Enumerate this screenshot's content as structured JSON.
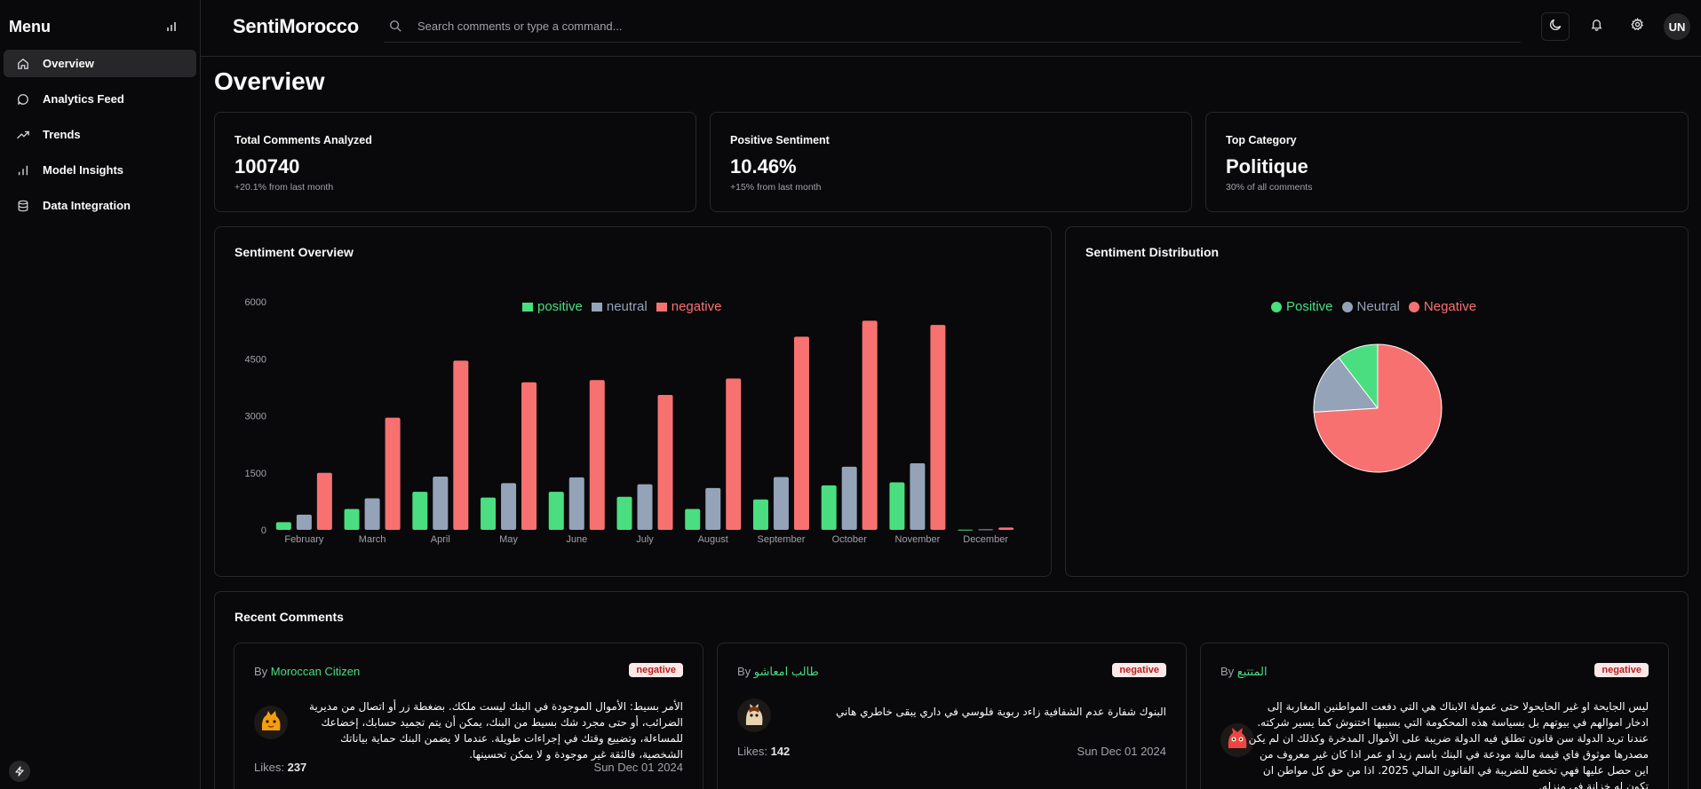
{
  "sidebar": {
    "title": "Menu",
    "items": [
      {
        "label": "Overview",
        "icon": "home-icon",
        "active": true
      },
      {
        "label": "Analytics Feed",
        "icon": "message-icon"
      },
      {
        "label": "Trends",
        "icon": "trending-up-icon"
      },
      {
        "label": "Model Insights",
        "icon": "bar-chart-icon"
      },
      {
        "label": "Data Integration",
        "icon": "database-icon"
      }
    ]
  },
  "header": {
    "brand": "SentiMorocco",
    "search_placeholder": "Search comments or type a command...",
    "avatar_initials": "UN"
  },
  "page": {
    "title": "Overview"
  },
  "stats": [
    {
      "label": "Total Comments Analyzed",
      "value": "100740",
      "sub": "+20.1% from last month"
    },
    {
      "label": "Positive Sentiment",
      "value": "10.46%",
      "sub": "+15% from last month"
    },
    {
      "label": "Top Category",
      "value": "Politique",
      "sub": "30% of all comments"
    }
  ],
  "sentiment_overview": {
    "title": "Sentiment Overview"
  },
  "sentiment_distribution": {
    "title": "Sentiment Distribution"
  },
  "chart_data": [
    {
      "type": "bar",
      "title": "Sentiment Overview",
      "categories": [
        "February",
        "March",
        "April",
        "May",
        "June",
        "July",
        "August",
        "September",
        "October",
        "November",
        "December"
      ],
      "series": [
        {
          "name": "positive",
          "color": "#4ade80",
          "values": [
            200,
            550,
            1000,
            850,
            1000,
            870,
            550,
            800,
            1170,
            1250,
            5
          ]
        },
        {
          "name": "neutral",
          "color": "#94a3b8",
          "values": [
            400,
            830,
            1400,
            1230,
            1380,
            1200,
            1100,
            1390,
            1660,
            1750,
            15
          ]
        },
        {
          "name": "negative",
          "color": "#f87171",
          "values": [
            1500,
            2950,
            4450,
            3880,
            3940,
            3550,
            3980,
            5080,
            5500,
            5390,
            60
          ]
        }
      ],
      "yticks": [
        0,
        1500,
        3000,
        4500,
        6000
      ],
      "ylim": [
        0,
        6000
      ],
      "legend": "top"
    },
    {
      "type": "pie",
      "title": "Sentiment Distribution",
      "slices": [
        {
          "name": "Positive",
          "color": "#4ade80",
          "value": 10.46
        },
        {
          "name": "Neutral",
          "color": "#94a3b8",
          "value": 15.5
        },
        {
          "name": "Negative",
          "color": "#f87171",
          "value": 74.04
        }
      ],
      "legend": "top"
    }
  ],
  "recent_comments": {
    "title": "Recent Comments",
    "by_prefix": "By",
    "likes_label": "Likes:",
    "items": [
      {
        "author": "Moroccan Citizen",
        "sentiment": "negative",
        "text": "الأمر بسيط: الأموال الموجودة في البنك ليست ملكك. بضغطة زر أو اتصال من مديرية الضرائب، أو حتى مجرد شك بسيط من البنك، يمكن أن يتم تجميد حسابك، إخضاعك للمساءلة، وتضييع وقتك في إجراءات طويلة. عندما لا يضمن البنك حماية بياناتك الشخصية، فالثقة غير موجودة و لا يمكن تحسينها.",
        "likes": "237",
        "date": "Sun Dec 01 2024"
      },
      {
        "author": "طالب امعاشو",
        "sentiment": "negative",
        "text": "البنوك شفارة عدم الشفافية زاءد ربوية فلوسي في داري يبقى خاطري هاني",
        "likes": "142",
        "date": "Sun Dec 01 2024"
      },
      {
        "author": "المتتبع",
        "sentiment": "negative",
        "text": "ليس الجايحة او غير الحايحولا حتى عمولة الابناك هي التي دفعت المواطنين المغاربة إلى ادخار اموالهم في بيوتهم بل بسياسة هذه المحكومة التي بسببها اختنوش كما يسير شركته. عندنا تريد الدولة سن قانون تطلق فيه الدولة ضريبة على الأموال المدخرة وكذلك ان لم يكن مصدرها موثوق فاي قيمة مالية مودعة في البنك باسم زيد او عمر اذا كان غير معروف من اين حصل عليها فهي تخضع للضريبة في القانون المالي 2025. اذا من حق كل مواطن ان تكون له خزانة في منزله.",
        "likes": "",
        "date": ""
      }
    ]
  }
}
